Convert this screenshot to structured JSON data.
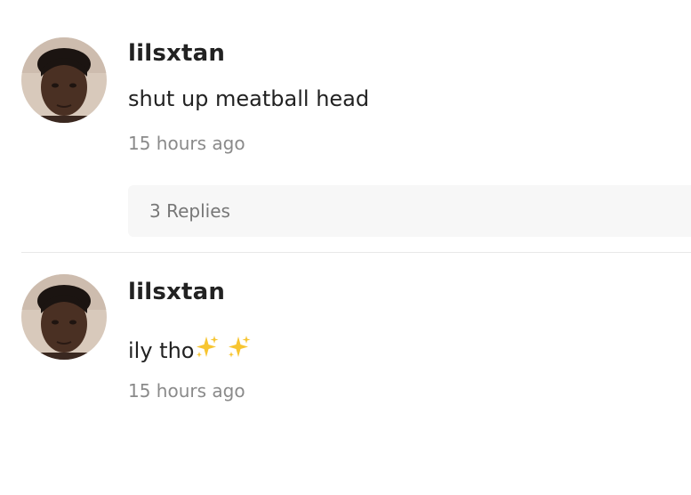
{
  "comments": [
    {
      "username": "lilsxtan",
      "body": "shut up meatball head",
      "timestamp": "15 hours ago",
      "replies_label": "3 Replies"
    },
    {
      "username": "lilsxtan",
      "body": "ily tho",
      "emoji": [
        "sparkles-icon",
        "sparkles-icon"
      ],
      "timestamp": "15 hours ago"
    }
  ],
  "colors": {
    "text": "#222222",
    "muted": "#8a8a8a",
    "replies_bg": "#f7f7f7",
    "divider": "#e8e8e8",
    "sparkle": "#f7c531"
  }
}
